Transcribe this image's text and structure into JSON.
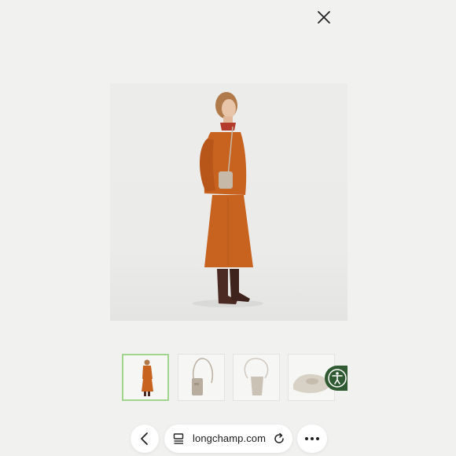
{
  "browser": {
    "url_label": "longchamp.com",
    "icons": {
      "close": "close-icon",
      "back": "chevron-left-icon",
      "reader": "reader-mode-icon",
      "reload": "reload-icon",
      "more": "more-icon",
      "accessibility": "accessibility-icon"
    }
  },
  "product": {
    "thumbnails": [
      {
        "name": "model-full-look",
        "selected": true
      },
      {
        "name": "bag-front",
        "selected": false
      },
      {
        "name": "bag-back",
        "selected": false
      },
      {
        "name": "bag-top",
        "selected": false
      }
    ]
  },
  "colors": {
    "outfit_orange": "#c8621f",
    "boots_brown": "#4a2a22",
    "bag_taupe": "#c7b9a8",
    "selected_border": "#9fd58c",
    "accessibility_green": "#305a32"
  }
}
